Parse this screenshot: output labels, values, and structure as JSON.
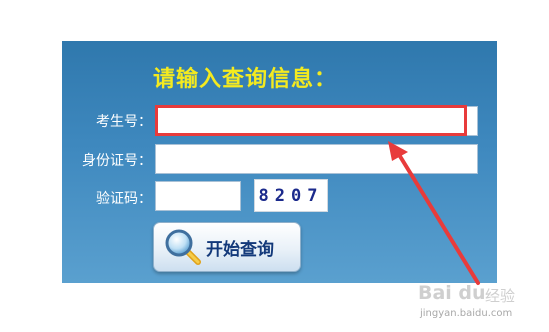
{
  "form": {
    "title": "请输入查询信息：",
    "exam_no_label": "考生号：",
    "exam_no_value": "",
    "id_no_label": "身份证号：",
    "id_no_value": "",
    "captcha_label": "验证码：",
    "captcha_value": "",
    "captcha_image_text": "8207",
    "submit_label": "开始查询"
  },
  "annotation": {
    "highlight_color": "#e83b3b"
  },
  "watermark": {
    "logo": "Bai du",
    "cn": "经验",
    "url": "jingyan.baidu.com"
  },
  "colors": {
    "panel": "#3a84ba",
    "title": "#f4ea1f",
    "button_text": "#13397a"
  }
}
